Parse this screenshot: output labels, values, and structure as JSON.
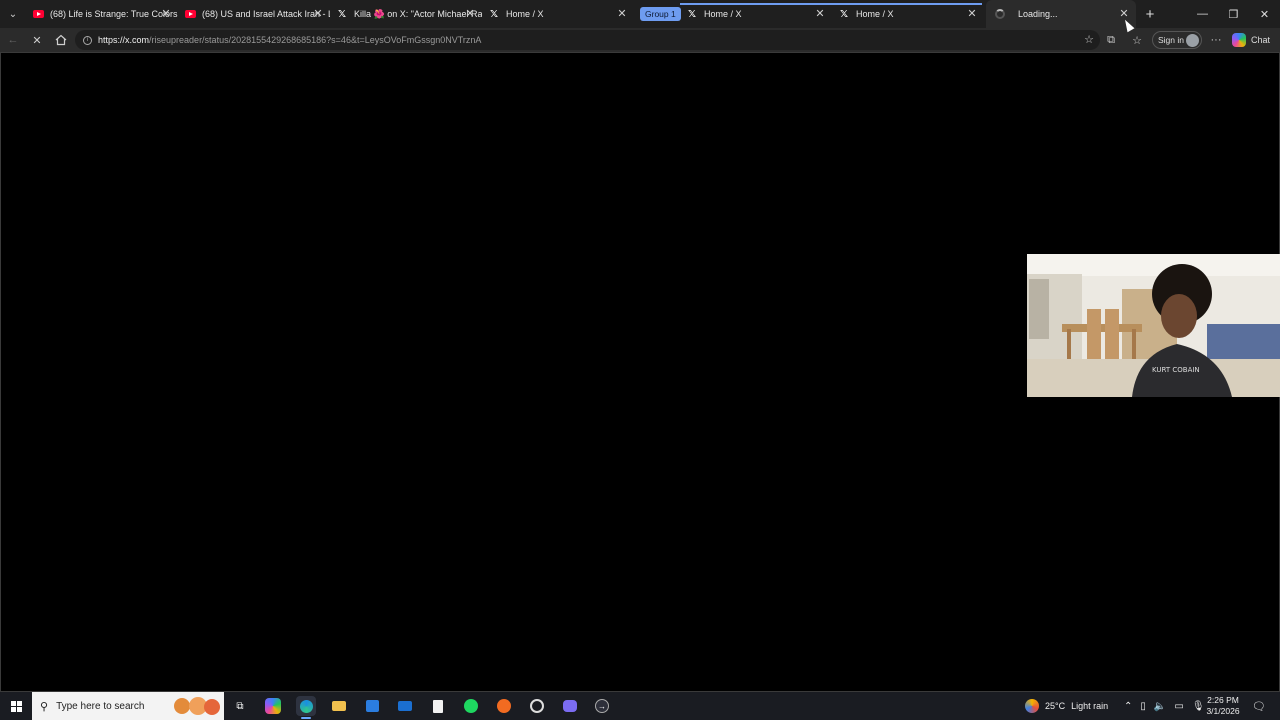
{
  "browser": {
    "tabs": [
      {
        "title": "(68) Life is Strange: True Colors",
        "favicon": "youtube-icon"
      },
      {
        "title": "(68) US and Israel Attack Iran - L",
        "favicon": "youtube-icon"
      },
      {
        "title": "Killa 🌺 on X: \"Actor Michael Ra",
        "favicon": "x-icon"
      },
      {
        "title": "Home / X",
        "favicon": "x-icon"
      },
      {
        "title": "Home / X",
        "favicon": "x-icon"
      },
      {
        "title": "Home / X",
        "favicon": "x-icon"
      },
      {
        "title": "Loading...",
        "favicon": "spinner-icon"
      }
    ],
    "group_label": "Group 1",
    "accent_color": "#6e9cf0",
    "address": {
      "host": "https://x.com",
      "rest": "/riseupreader/status/2028155429268685186?s=46&t=LeysOVoFmGssgn0NVTrznA"
    },
    "signin_label": "Sign in",
    "chat_label": "Chat"
  },
  "taskbar": {
    "search_placeholder": "Type here to search",
    "weather": {
      "temp": "25°C",
      "condition": "Light rain"
    },
    "clock": {
      "time": "2:26 PM",
      "date": "3/1/2026"
    },
    "pinned": [
      "task-view-icon",
      "copilot-icon",
      "edge-icon",
      "file-explorer-icon",
      "store-icon",
      "mail-icon",
      "notepad-icon",
      "spotify-icon",
      "app-icon",
      "media-icon",
      "discord-icon",
      "app-arrow-icon"
    ]
  }
}
